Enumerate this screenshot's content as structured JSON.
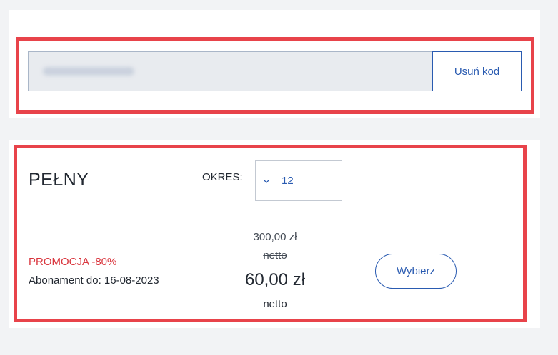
{
  "discount_code": {
    "remove_label": "Usuń kod"
  },
  "plan": {
    "title": "PEŁNY",
    "period_label": "OKRES:",
    "period_value": "12",
    "promo_text": "PROMOCJA -80%",
    "valid_until": "Abonament do: 16-08-2023",
    "old_price": "300,00 zł",
    "old_price_unit": "netto",
    "new_price": "60,00 zł",
    "new_price_unit": "netto",
    "choose_label": "Wybierz"
  },
  "colors": {
    "accent": "#2a5bb1",
    "highlight": "#e8434a",
    "promo": "#d9363e"
  }
}
